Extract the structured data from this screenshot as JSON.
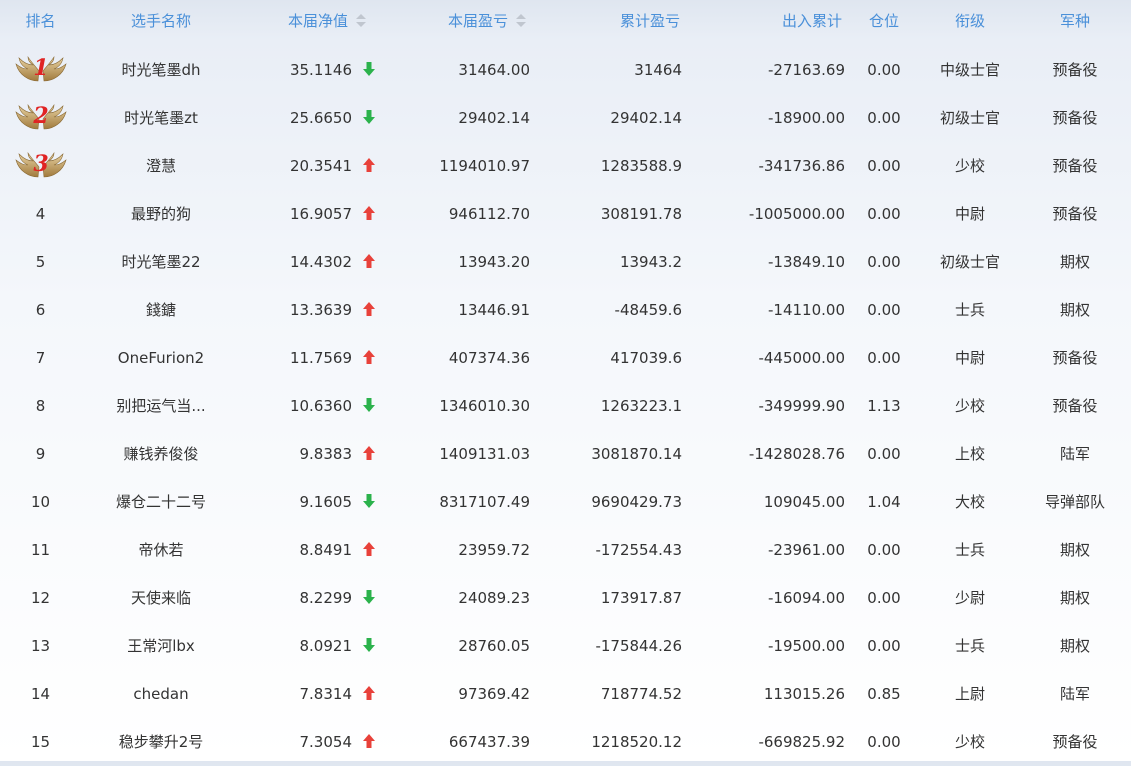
{
  "header": {
    "rank": "排名",
    "name": "选手名称",
    "nav": "本届净值",
    "pnl": "本届盈亏",
    "cum_pnl": "累计盈亏",
    "flow": "出入累计",
    "position": "仓位",
    "title": "衔级",
    "branch": "军种"
  },
  "colors": {
    "header_text": "#4a90d9",
    "up": "#e8413a",
    "down": "#2bb24c",
    "medal_number": "#e02424"
  },
  "rows": [
    {
      "rank": "1",
      "name": "时光笔墨dh",
      "nav": "35.1146",
      "trend": "down",
      "pnl": "31464.00",
      "cum": "31464",
      "flow": "-27163.69",
      "pos": "0.00",
      "title": "中级士官",
      "branch": "预备役"
    },
    {
      "rank": "2",
      "name": "时光笔墨zt",
      "nav": "25.6650",
      "trend": "down",
      "pnl": "29402.14",
      "cum": "29402.14",
      "flow": "-18900.00",
      "pos": "0.00",
      "title": "初级士官",
      "branch": "预备役"
    },
    {
      "rank": "3",
      "name": "澄慧",
      "nav": "20.3541",
      "trend": "up",
      "pnl": "1194010.97",
      "cum": "1283588.9",
      "flow": "-341736.86",
      "pos": "0.00",
      "title": "少校",
      "branch": "预备役"
    },
    {
      "rank": "4",
      "name": "最野的狗",
      "nav": "16.9057",
      "trend": "up",
      "pnl": "946112.70",
      "cum": "308191.78",
      "flow": "-1005000.00",
      "pos": "0.00",
      "title": "中尉",
      "branch": "预备役"
    },
    {
      "rank": "5",
      "name": "时光笔墨22",
      "nav": "14.4302",
      "trend": "up",
      "pnl": "13943.20",
      "cum": "13943.2",
      "flow": "-13849.10",
      "pos": "0.00",
      "title": "初级士官",
      "branch": "期权"
    },
    {
      "rank": "6",
      "name": "錢鎕",
      "nav": "13.3639",
      "trend": "up",
      "pnl": "13446.91",
      "cum": "-48459.6",
      "flow": "-14110.00",
      "pos": "0.00",
      "title": "士兵",
      "branch": "期权"
    },
    {
      "rank": "7",
      "name": "OneFurion2",
      "nav": "11.7569",
      "trend": "up",
      "pnl": "407374.36",
      "cum": "417039.6",
      "flow": "-445000.00",
      "pos": "0.00",
      "title": "中尉",
      "branch": "预备役"
    },
    {
      "rank": "8",
      "name": "别把运气当...",
      "nav": "10.6360",
      "trend": "down",
      "pnl": "1346010.30",
      "cum": "1263223.1",
      "flow": "-349999.90",
      "pos": "1.13",
      "title": "少校",
      "branch": "预备役"
    },
    {
      "rank": "9",
      "name": "赚钱养俊俊",
      "nav": "9.8383",
      "trend": "up",
      "pnl": "1409131.03",
      "cum": "3081870.14",
      "flow": "-1428028.76",
      "pos": "0.00",
      "title": "上校",
      "branch": "陆军"
    },
    {
      "rank": "10",
      "name": "爆仓二十二号",
      "nav": "9.1605",
      "trend": "down",
      "pnl": "8317107.49",
      "cum": "9690429.73",
      "flow": "109045.00",
      "pos": "1.04",
      "title": "大校",
      "branch": "导弹部队"
    },
    {
      "rank": "11",
      "name": "帝休若",
      "nav": "8.8491",
      "trend": "up",
      "pnl": "23959.72",
      "cum": "-172554.43",
      "flow": "-23961.00",
      "pos": "0.00",
      "title": "士兵",
      "branch": "期权"
    },
    {
      "rank": "12",
      "name": "天使来临",
      "nav": "8.2299",
      "trend": "down",
      "pnl": "24089.23",
      "cum": "173917.87",
      "flow": "-16094.00",
      "pos": "0.00",
      "title": "少尉",
      "branch": "期权"
    },
    {
      "rank": "13",
      "name": "王常河lbx",
      "nav": "8.0921",
      "trend": "down",
      "pnl": "28760.05",
      "cum": "-175844.26",
      "flow": "-19500.00",
      "pos": "0.00",
      "title": "士兵",
      "branch": "期权"
    },
    {
      "rank": "14",
      "name": "chedan",
      "nav": "7.8314",
      "trend": "up",
      "pnl": "97369.42",
      "cum": "718774.52",
      "flow": "113015.26",
      "pos": "0.85",
      "title": "上尉",
      "branch": "陆军"
    },
    {
      "rank": "15",
      "name": "稳步攀升2号",
      "nav": "7.3054",
      "trend": "up",
      "pnl": "667437.39",
      "cum": "1218520.12",
      "flow": "-669825.92",
      "pos": "0.00",
      "title": "少校",
      "branch": "预备役"
    }
  ]
}
